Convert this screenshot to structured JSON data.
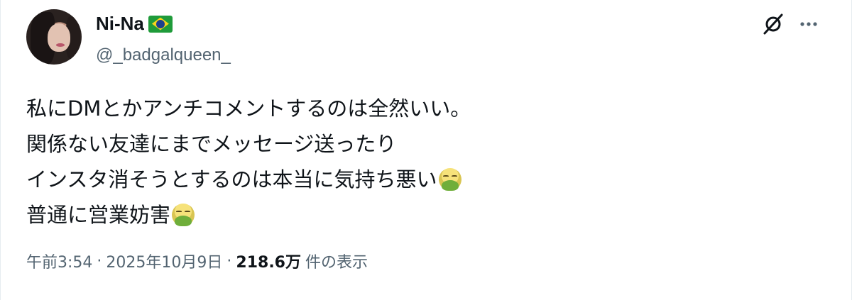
{
  "author": {
    "display_name": "Ni-Na",
    "flag_icon": "brazil-flag-icon",
    "handle": "@_badgalqueen_"
  },
  "tweet": {
    "lines": [
      "私にDMとかアンチコメントするのは全然いい。",
      "関係ない友達にまでメッセージ送ったり",
      "インスタ消そうとするのは本当に気持ち悪い",
      "普通に営業妨害"
    ],
    "emoji_icon": "nauseated-face-emoji-icon"
  },
  "meta": {
    "time": "午前3:54",
    "separator": "·",
    "date": "2025年10月9日",
    "views_count": "218.6万",
    "views_label": "件の表示"
  },
  "actions": {
    "grok_icon": "grok-icon",
    "more_icon": "more-options-icon"
  },
  "colors": {
    "text_primary": "#0f1419",
    "text_secondary": "#536471"
  }
}
